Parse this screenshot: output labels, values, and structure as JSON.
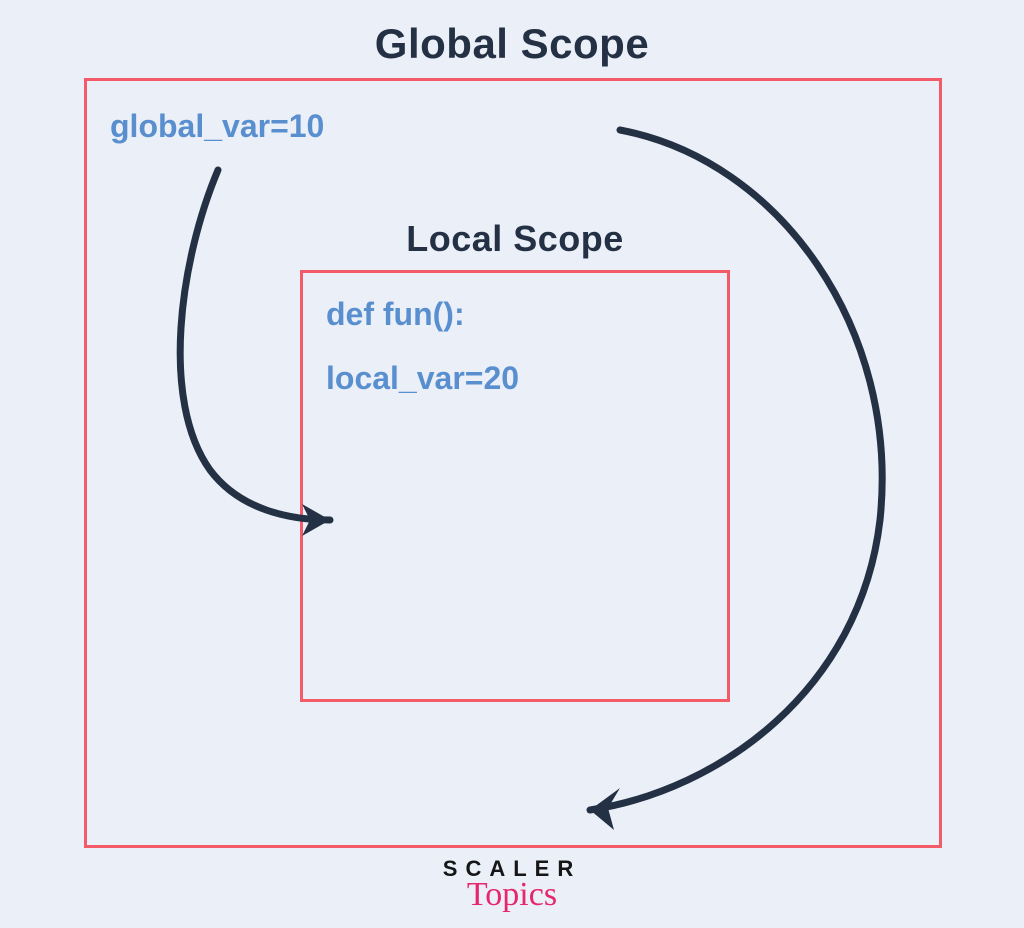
{
  "titles": {
    "global": "Global Scope",
    "local": "Local Scope"
  },
  "code": {
    "global_var": "global_var=10",
    "def_line": "def fun():",
    "local_var": "local_var=20"
  },
  "brand": {
    "line1": "SCALER",
    "line2": "Topics"
  },
  "colors": {
    "background": "#eaeff8",
    "box_border": "#f45b69",
    "title_text": "#243043",
    "code_text": "#5a8fcf",
    "arrow": "#243043",
    "brand_accent": "#e6266e"
  },
  "diagram": {
    "description": "Nested scope boxes. Outer red box is Global Scope containing global_var=10. Inner red box is Local Scope containing def fun(): and local_var=20. One arrow curves from global_var into the local box. A second larger arrow curves from the top-right of the global box down past the local box to the bottom of the global box.",
    "arrows": [
      {
        "from": "global_var",
        "to": "local_scope_box"
      },
      {
        "from": "global_scope_top",
        "to": "global_scope_bottom",
        "around": "local_scope_box"
      }
    ]
  }
}
